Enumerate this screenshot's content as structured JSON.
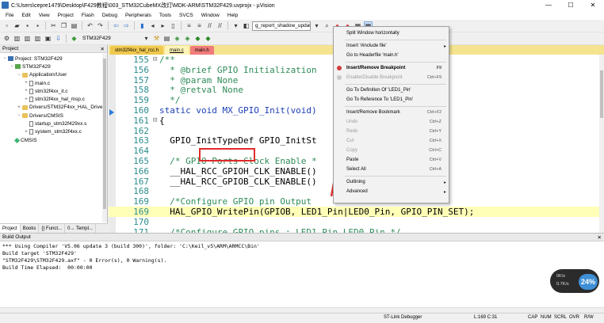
{
  "window": {
    "title": "C:\\Users\\cepre1479\\Desktop\\F429教程\\003_STM32CubeMX改灯\\MDK-ARM\\STM32F429.uvprojx - µVision",
    "minimize": "—",
    "maximize": "☐",
    "close": "✕"
  },
  "menubar": [
    "File",
    "Edit",
    "View",
    "Project",
    "Flash",
    "Debug",
    "Peripherals",
    "Tools",
    "SVCS",
    "Window",
    "Help"
  ],
  "toolbar": {
    "find_combo": "g_report_shadow_updat",
    "target_combo": "STM32F429"
  },
  "project_panel": {
    "title": "Project",
    "pin": "📌",
    "close": "✕",
    "tree": [
      {
        "label": "Project: STM32F429",
        "level": 0,
        "icon": "project",
        "expander": "−"
      },
      {
        "label": "STM32F429",
        "level": 1,
        "icon": "target",
        "expander": "−"
      },
      {
        "label": "Application/User",
        "level": 2,
        "icon": "folder",
        "expander": "−"
      },
      {
        "label": "main.c",
        "level": 3,
        "icon": "file",
        "expander": "+"
      },
      {
        "label": "stm32f4xx_it.c",
        "level": 3,
        "icon": "file",
        "expander": "+"
      },
      {
        "label": "stm32f4xx_hal_msp.c",
        "level": 3,
        "icon": "file",
        "expander": "+"
      },
      {
        "label": "Drivers/STM32F4xx_HAL_Drive",
        "level": 2,
        "icon": "folder",
        "expander": "+"
      },
      {
        "label": "Drivers/CMSIS",
        "level": 2,
        "icon": "folder",
        "expander": "−"
      },
      {
        "label": "startup_stm32f429xx.s",
        "level": 3,
        "icon": "file",
        "expander": ""
      },
      {
        "label": "system_stm32f4xx.c",
        "level": 3,
        "icon": "file",
        "expander": "+"
      },
      {
        "label": "CMSIS",
        "level": 1,
        "icon": "gem",
        "expander": ""
      }
    ],
    "tabs": [
      "Project",
      "Books",
      "{} Funct...",
      "0→ Templ..."
    ]
  },
  "editor": {
    "tabs": [
      {
        "label": "stm32f4xx_hal_rcc.h",
        "style": "yellow"
      },
      {
        "label": "main.c",
        "style": "active"
      },
      {
        "label": "main.h",
        "style": "red"
      }
    ],
    "lines": [
      {
        "num": "155",
        "fold": "⊟",
        "text": "/**",
        "kind": "cmt"
      },
      {
        "num": "156",
        "fold": "",
        "text": "  * @brief GPIO Initialization",
        "kind": "cmt"
      },
      {
        "num": "157",
        "fold": "",
        "text": "  * @param None",
        "kind": "cmt"
      },
      {
        "num": "158",
        "fold": "",
        "text": "  * @retval None",
        "kind": "cmt"
      },
      {
        "num": "159",
        "fold": "",
        "text": "  */",
        "kind": "cmt"
      },
      {
        "num": "160",
        "fold": "",
        "text": "static void MX_GPIO_Init(void)",
        "kind": "kw"
      },
      {
        "num": "161",
        "fold": "⊟",
        "text": "{",
        "kind": "plain"
      },
      {
        "num": "162",
        "fold": "",
        "text": "",
        "kind": "plain"
      },
      {
        "num": "163",
        "fold": "",
        "text": "  GPIO_InitTypeDef GPIO_InitSt",
        "kind": "plain"
      },
      {
        "num": "164",
        "fold": "",
        "text": "",
        "kind": "plain"
      },
      {
        "num": "165",
        "fold": "",
        "text": "  /* GPIO Ports Clock Enable *",
        "kind": "cmt"
      },
      {
        "num": "166",
        "fold": "",
        "text": "  __HAL_RCC_GPIOH_CLK_ENABLE()",
        "kind": "plain"
      },
      {
        "num": "167",
        "fold": "",
        "text": "  __HAL_RCC_GPIOB_CLK_ENABLE()",
        "kind": "plain"
      },
      {
        "num": "168",
        "fold": "",
        "text": "",
        "kind": "plain"
      },
      {
        "num": "169",
        "fold": "",
        "text": "  /*Configure GPIO pin Output",
        "kind": "cmt"
      },
      {
        "num": "169",
        "fold": "",
        "text": "  HAL_GPIO_WritePin(GPIOB, LED1_Pin|LED0_Pin, GPIO_PIN_SET);",
        "kind": "hl"
      },
      {
        "num": "170",
        "fold": "",
        "text": "",
        "kind": "plain"
      },
      {
        "num": "171",
        "fold": "",
        "text": "  /*Configure GPIO pins : LED1_Pin LED0_Pin */",
        "kind": "cmt"
      }
    ]
  },
  "context_menu": {
    "items": [
      {
        "label": "Split Window horizontally",
        "shortcut": "",
        "disabled": false,
        "submenu": false,
        "bold": false,
        "icon": ""
      },
      {
        "sep": true
      },
      {
        "label": "Insert '#include file'",
        "shortcut": "",
        "disabled": false,
        "submenu": true,
        "bold": false,
        "icon": ""
      },
      {
        "label": "Go to Headerfile 'main.h'",
        "shortcut": "",
        "disabled": false,
        "submenu": false,
        "bold": false,
        "icon": ""
      },
      {
        "sep": true
      },
      {
        "label": "Insert/Remove Breakpoint",
        "shortcut": "F9",
        "disabled": false,
        "submenu": false,
        "bold": true,
        "icon": "breakpoint"
      },
      {
        "label": "Enable/Disable Breakpoint",
        "shortcut": "Ctrl+F9",
        "disabled": true,
        "submenu": false,
        "bold": false,
        "icon": "breakpoint-off"
      },
      {
        "sep": true
      },
      {
        "label": "Go To Definition Of 'LED1_Pin'",
        "shortcut": "",
        "disabled": false,
        "submenu": false,
        "bold": false,
        "icon": ""
      },
      {
        "label": "Go To Reference To 'LED1_Pin'",
        "shortcut": "",
        "disabled": false,
        "submenu": false,
        "bold": false,
        "icon": ""
      },
      {
        "sep": true
      },
      {
        "label": "Insert/Remove Bookmark",
        "shortcut": "Ctrl+F2",
        "disabled": false,
        "submenu": false,
        "bold": false,
        "icon": ""
      },
      {
        "label": "Undo",
        "shortcut": "Ctrl+Z",
        "disabled": true,
        "submenu": false,
        "bold": false,
        "icon": ""
      },
      {
        "label": "Redo",
        "shortcut": "Ctrl+Y",
        "disabled": true,
        "submenu": false,
        "bold": false,
        "icon": ""
      },
      {
        "label": "Cut",
        "shortcut": "Ctrl+X",
        "disabled": true,
        "submenu": false,
        "bold": false,
        "icon": ""
      },
      {
        "label": "Copy",
        "shortcut": "Ctrl+C",
        "disabled": true,
        "submenu": false,
        "bold": false,
        "icon": ""
      },
      {
        "label": "Paste",
        "shortcut": "Ctrl+V",
        "disabled": false,
        "submenu": false,
        "bold": false,
        "icon": ""
      },
      {
        "label": "Select All",
        "shortcut": "Ctrl+A",
        "disabled": false,
        "submenu": false,
        "bold": false,
        "icon": ""
      },
      {
        "sep": true
      },
      {
        "label": "Outlining",
        "shortcut": "",
        "disabled": false,
        "submenu": true,
        "bold": false,
        "icon": ""
      },
      {
        "label": "Advanced",
        "shortcut": "",
        "disabled": false,
        "submenu": true,
        "bold": false,
        "icon": ""
      }
    ]
  },
  "build_output": {
    "title": "Build Output",
    "lines": [
      "*** Using Compiler 'V5.06 update 3 (build 300)', folder: 'C:\\Keil_v5\\ARM\\ARMCC\\Bin'",
      "Build target 'STM32F429'",
      "\"STM32F429\\STM32F429.axf\" - 0 Error(s), 0 Warning(s).",
      "Build Time Elapsed:  00:00:00"
    ]
  },
  "status": {
    "debugger": "ST-Link Debugger",
    "position": "L:169 C:31",
    "caps": "CAP",
    "num": "NUM",
    "scrl": "SCRL",
    "ovr": "OVR",
    "rw": "R/W"
  },
  "net_widget": {
    "up": "0K/s",
    "down": "0.7K/s",
    "percent": "24%"
  },
  "colors": {
    "tab_bar": "#f5e38f",
    "highlight_line": "#ffffb8",
    "annotation_red": "#e02a2a",
    "comment": "#2e8b57",
    "keyword": "#1b3fb3",
    "line_number": "#2b8c8c"
  }
}
